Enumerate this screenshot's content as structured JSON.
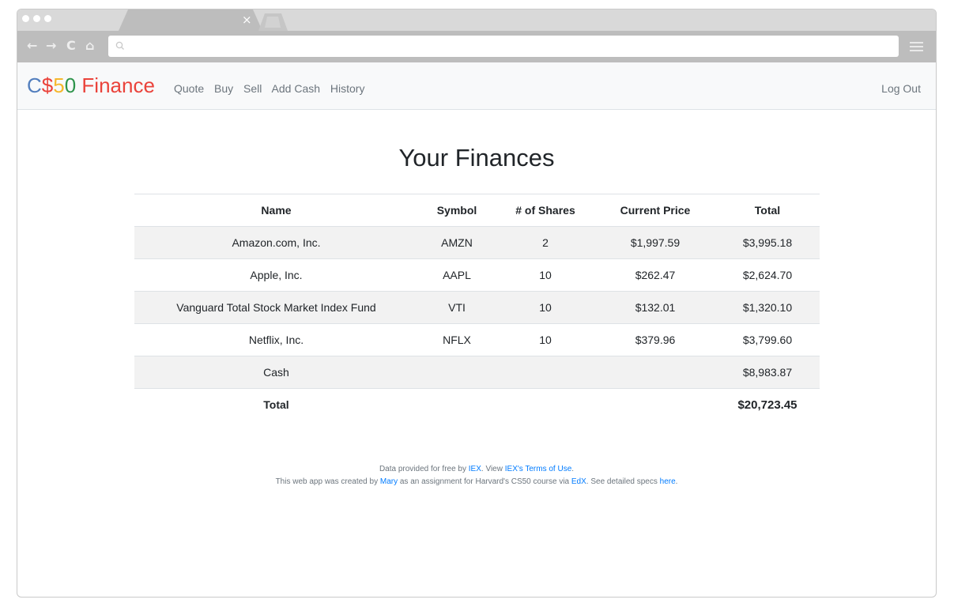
{
  "brand": {
    "c": "C",
    "dollar": "$",
    "five": "5",
    "zero": "0",
    "finance": " Finance"
  },
  "nav": {
    "links": [
      "Quote",
      "Buy",
      "Sell",
      "Add Cash",
      "History"
    ],
    "logout": "Log Out"
  },
  "browser": {
    "tab_close": "×",
    "back": "←",
    "forward": "→",
    "reload": "C",
    "home": "⌂"
  },
  "page": {
    "title": "Your Finances"
  },
  "table": {
    "headers": [
      "Name",
      "Symbol",
      "# of Shares",
      "Current Price",
      "Total"
    ],
    "rows": [
      [
        "Amazon.com, Inc.",
        "AMZN",
        "2",
        "$1,997.59",
        "$3,995.18"
      ],
      [
        "Apple, Inc.",
        "AAPL",
        "10",
        "$262.47",
        "$2,624.70"
      ],
      [
        "Vanguard Total Stock Market Index Fund",
        "VTI",
        "10",
        "$132.01",
        "$1,320.10"
      ],
      [
        "Netflix, Inc.",
        "NFLX",
        "10",
        "$379.96",
        "$3,799.60"
      ]
    ],
    "cash": {
      "label": "Cash",
      "value": "$8,983.87"
    },
    "total": {
      "label": "Total",
      "value": "$20,723.45"
    }
  },
  "footer": {
    "line1_pre": "Data provided for free by ",
    "line1_link1": "IEX",
    "line1_mid": ". View ",
    "line1_link2": "IEX's Terms of Use",
    "line1_end": ".",
    "line2_pre": "This web app was created by ",
    "line2_link1": "Mary",
    "line2_mid": " as an assignment for Harvard's CS50 course via ",
    "line2_link2": "EdX",
    "line2_mid2": ". See detailed specs ",
    "line2_link3": "here",
    "line2_end": "."
  },
  "colors": {
    "brand_blue": "#537fbe",
    "brand_red": "#ea433b",
    "brand_yellow": "#f5b82e",
    "brand_green": "#2e944b",
    "link": "#007bff"
  }
}
